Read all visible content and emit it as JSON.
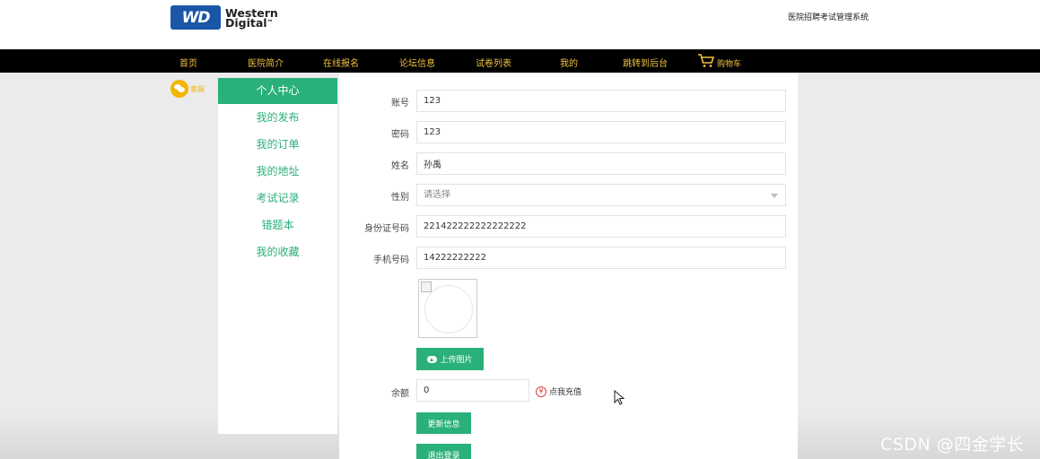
{
  "header": {
    "logo_mark": "WD",
    "logo_line1": "Western",
    "logo_line2": "Digital",
    "logo_tm": "™",
    "site_title": "医院招聘考试管理系统"
  },
  "nav": {
    "items": [
      "首页",
      "医院简介",
      "在线报名",
      "论坛信息",
      "试卷列表",
      "我的",
      "跳转到后台"
    ],
    "cart_label": "购物车"
  },
  "kefu_label": "客服",
  "sidebar": {
    "items": [
      "个人中心",
      "我的发布",
      "我的订单",
      "我的地址",
      "考试记录",
      "错题本",
      "我的收藏"
    ],
    "active_index": 0
  },
  "form": {
    "account": {
      "label": "账号",
      "value": "123"
    },
    "password": {
      "label": "密码",
      "value": "123"
    },
    "name": {
      "label": "姓名",
      "value": "孙禹"
    },
    "gender": {
      "label": "性别",
      "placeholder": "请选择"
    },
    "id_card": {
      "label": "身份证号码",
      "value": "221422222222222222"
    },
    "phone": {
      "label": "手机号码",
      "value": "14222222222"
    },
    "upload_button": "上传图片",
    "balance": {
      "label": "余额",
      "value": "0"
    },
    "recharge_label": "点我充值",
    "recharge_icon": "¥",
    "update_button": "更新信息",
    "logout_button": "退出登录"
  },
  "colors": {
    "accent": "#2ab07a",
    "nav_bg": "#000000",
    "nav_text": "#f0c040",
    "kefu": "#f4b400",
    "logo_blue": "#1a56a8"
  },
  "icons": [
    "cart-icon",
    "wechat-icon",
    "cloud-upload-icon",
    "yen-icon",
    "mouse-cursor-icon",
    "dropdown-arrow-icon"
  ],
  "watermark": "CSDN @四金学长"
}
